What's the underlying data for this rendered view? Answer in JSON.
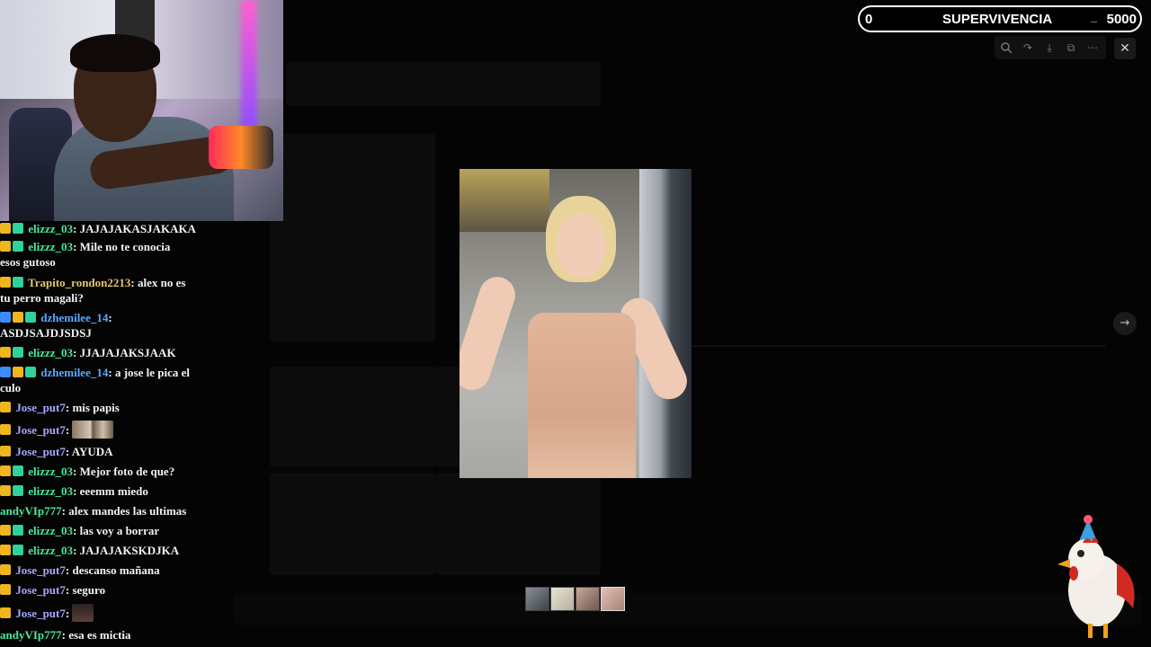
{
  "score_bar": {
    "left_value": "0",
    "title": "SUPERVIVENCIA",
    "separator": "_",
    "right_value": "5000"
  },
  "toolbar": {
    "zoom_icon": "zoom-in-icon",
    "rotate_icon": "rotate-icon",
    "download_icon": "download-icon",
    "open_icon": "open-external-icon",
    "more_icon": "more-icon",
    "close_icon": "close-icon",
    "next_icon": "arrow-right-icon"
  },
  "chat": [
    {
      "badges": [
        "crown",
        "green"
      ],
      "user": "elizzz_03",
      "user_color": "green",
      "message": "JAJAJAKASJAKAKA"
    },
    {
      "badges": [
        "crown",
        "green"
      ],
      "user": "elizzz_03",
      "user_color": "green",
      "message": "Mile no te conocia",
      "message2": "esos gutoso"
    },
    {
      "badges": [
        "crown",
        "green"
      ],
      "user": "Trapito_rondon2213",
      "user_color": "gold",
      "message": "alex no es",
      "message2": "tu perro magali?"
    },
    {
      "badges": [
        "arrow",
        "crown",
        "green"
      ],
      "user": "dzhemilee_14",
      "user_color": "blue",
      "message": "",
      "message2": "ASDJSAJDJSDSJ"
    },
    {
      "badges": [
        "crown",
        "green"
      ],
      "user": "elizzz_03",
      "user_color": "green",
      "message": "JJAJAJAKSJAAK"
    },
    {
      "badges": [
        "arrow",
        "crown",
        "green"
      ],
      "user": "dzhemilee_14",
      "user_color": "blue",
      "message": "a jose le pica el",
      "message2": "culo"
    },
    {
      "badges": [
        "crown"
      ],
      "user": "Jose_put7",
      "user_color": "lavender",
      "message": "mis papis"
    },
    {
      "badges": [
        "crown"
      ],
      "user": "Jose_put7",
      "user_color": "lavender",
      "message": "",
      "emote": "pair"
    },
    {
      "badges": [
        "crown"
      ],
      "user": "Jose_put7",
      "user_color": "lavender",
      "message": "AYUDA"
    },
    {
      "badges": [
        "crown",
        "green"
      ],
      "user": "elizzz_03",
      "user_color": "green",
      "message": "Mejor foto de que?"
    },
    {
      "badges": [
        "crown",
        "green"
      ],
      "user": "elizzz_03",
      "user_color": "green",
      "message": "eeemm miedo"
    },
    {
      "badges": [],
      "user": "andyVIp777",
      "user_color": "green",
      "message": "alex mandes las ultimas"
    },
    {
      "badges": [
        "crown",
        "green"
      ],
      "user": "elizzz_03",
      "user_color": "green",
      "message": "las voy a borrar"
    },
    {
      "badges": [
        "crown",
        "green"
      ],
      "user": "elizzz_03",
      "user_color": "green",
      "message": "JAJAJAKSKDJKA"
    },
    {
      "badges": [
        "crown"
      ],
      "user": "Jose_put7",
      "user_color": "lavender",
      "message": "descanso mañana"
    },
    {
      "badges": [
        "crown"
      ],
      "user": "Jose_put7",
      "user_color": "lavender",
      "message": "seguro"
    },
    {
      "badges": [
        "crown"
      ],
      "user": "Jose_put7",
      "user_color": "lavender",
      "message": "",
      "emote": "single"
    },
    {
      "badges": [],
      "user": "andyVIp777",
      "user_color": "green",
      "message": "esa es mictia"
    }
  ]
}
